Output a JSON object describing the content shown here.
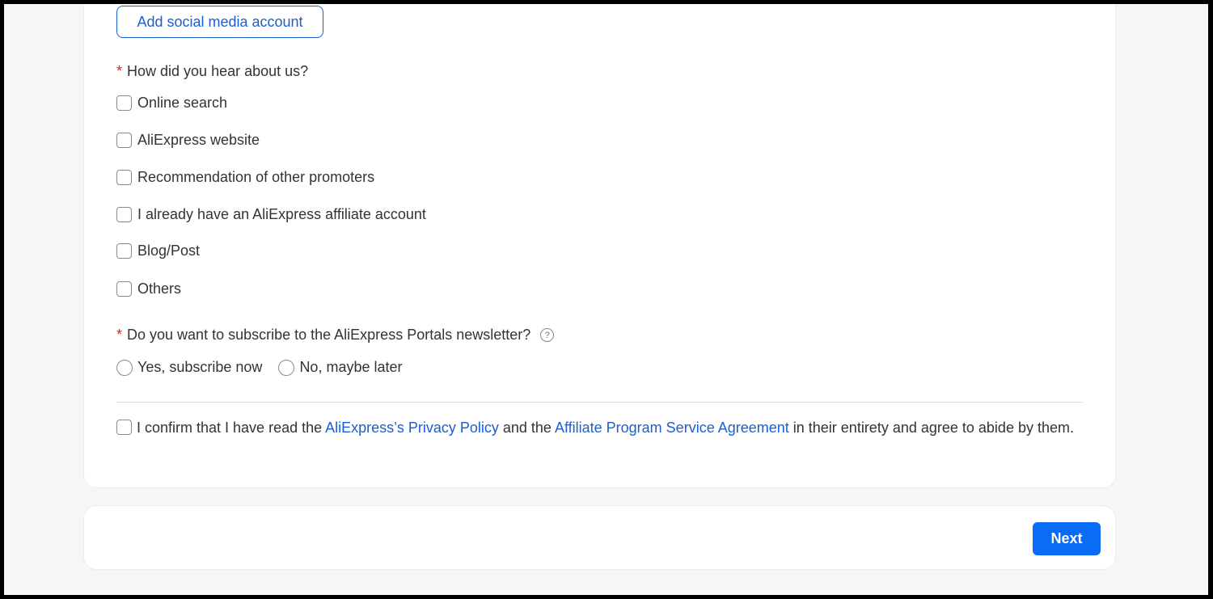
{
  "social": {
    "add_button": "Add social media account"
  },
  "hear_about": {
    "required_mark": "*",
    "question": "How did you hear about us?",
    "options": [
      "Online search",
      "AliExpress website",
      "Recommendation of other promoters",
      "I already have an AliExpress affiliate account",
      "Blog/Post",
      "Others"
    ]
  },
  "newsletter": {
    "required_mark": "*",
    "question": "Do you want to subscribe to the AliExpress Portals newsletter?",
    "help_icon": "?",
    "options": [
      "Yes, subscribe now",
      "No, maybe later"
    ]
  },
  "confirm": {
    "text_1": "I confirm that I have read the ",
    "privacy_link": "AliExpress’s Privacy Policy",
    "text_2": " and the ",
    "agreement_link": "Affiliate Program Service Agreement",
    "text_3": " in their entirety and agree to abide by them."
  },
  "footer": {
    "next_button": "Next"
  },
  "colors": {
    "accent": "#0a6cf5",
    "link": "#1a5fd1",
    "required": "#e02020"
  }
}
